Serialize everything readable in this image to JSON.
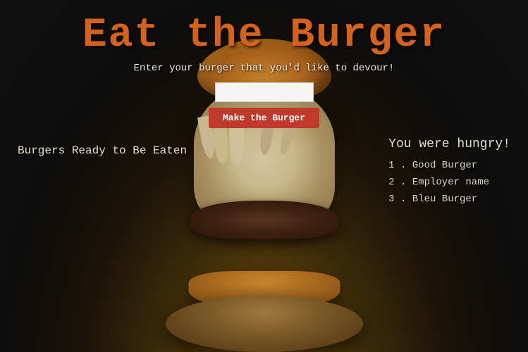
{
  "page": {
    "title": "Eat the Burger",
    "subtitle": "Enter your burger that you'd like to devour!",
    "background_color": "#1a1a1a",
    "accent_color": "#d4621a"
  },
  "form": {
    "input_placeholder": "",
    "input_value": "",
    "button_label": "Make the Burger"
  },
  "left_panel": {
    "heading": "Burgers Ready to Be Eaten"
  },
  "right_panel": {
    "heading": "You were hungry!",
    "items": [
      {
        "number": "1",
        "name": "Good Burger"
      },
      {
        "number": "2",
        "name": "Employer name"
      },
      {
        "number": "3",
        "name": "Bleu Burger"
      }
    ]
  }
}
